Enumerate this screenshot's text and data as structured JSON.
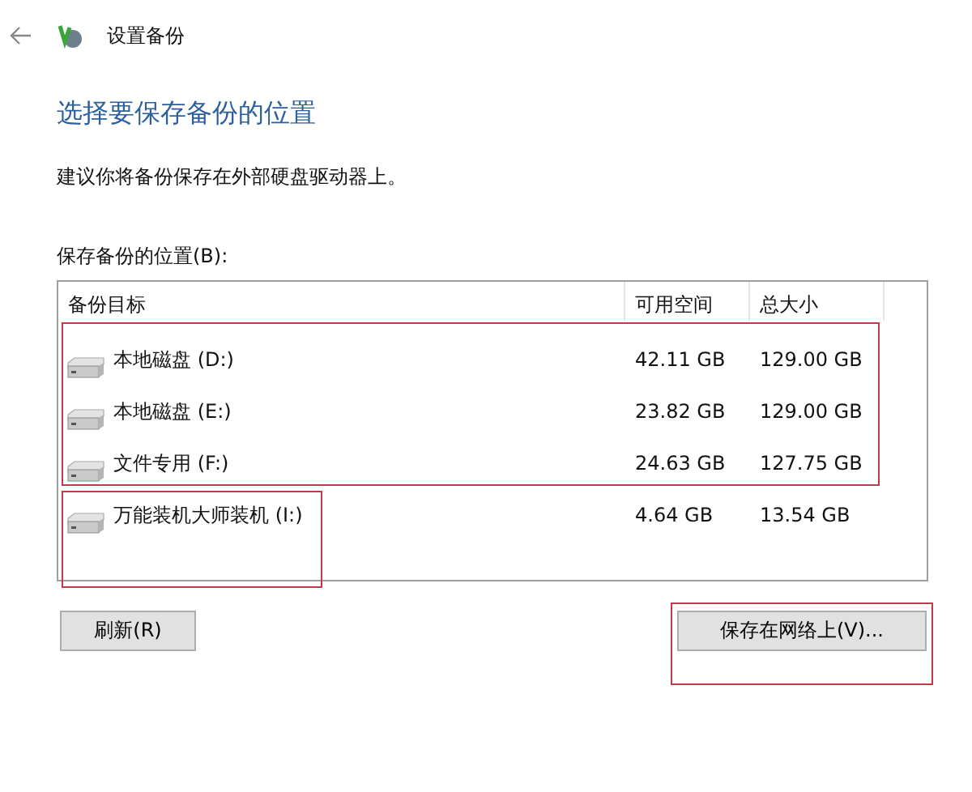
{
  "window": {
    "title": "设置备份"
  },
  "heading": "选择要保存备份的位置",
  "description": "建议你将备份保存在外部硬盘驱动器上。",
  "list_label": "保存备份的位置(B):",
  "table": {
    "columns": [
      "备份目标",
      "可用空间",
      "总大小"
    ],
    "rows": [
      {
        "name": "本地磁盘 (D:)",
        "free": "42.11 GB",
        "total": "129.00 GB"
      },
      {
        "name": "本地磁盘 (E:)",
        "free": "23.82 GB",
        "total": "129.00 GB"
      },
      {
        "name": "文件专用 (F:)",
        "free": "24.63 GB",
        "total": "127.75 GB"
      },
      {
        "name": "万能装机大师装机 (I:)",
        "free": "4.64 GB",
        "total": "13.54 GB"
      }
    ]
  },
  "buttons": {
    "refresh": "刷新(R)",
    "network": "保存在网络上(V)..."
  }
}
